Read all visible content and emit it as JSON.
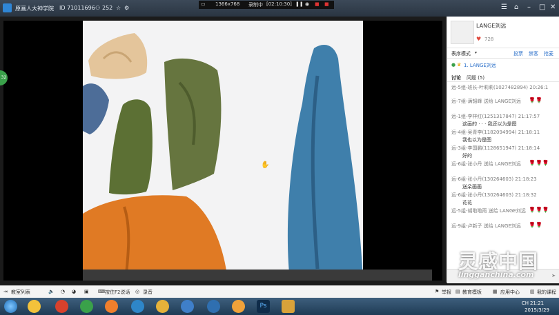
{
  "window": {
    "room_name": "原画人大神学院",
    "room_id": "ID 71011696",
    "online_count": "252"
  },
  "recorder": {
    "resolution": "1366x768",
    "status": "录制中",
    "time": "[02:10:30]"
  },
  "streamer": {
    "name": "LANGE刘远",
    "likes": "728"
  },
  "panel": {
    "mode_label": "表序模式",
    "links": [
      "投票",
      "禁客",
      "抢麦"
    ],
    "mic_queue_item": "1. LANGE刘远",
    "tabs": [
      "讨论",
      "问题 (5)"
    ],
    "comments": [
      {
        "type": "msg",
        "name": "远-5组-班长-叶莉莉(1027482894) 20:26:1",
        "text": ""
      },
      {
        "type": "gift",
        "name": "远-7组-满韶峰 送给 LANGE刘远",
        "count": 2
      },
      {
        "type": "msg",
        "name": "远-1组-李梓红(1251317847) 21:17:57",
        "text": "这画的 · · · 我还以为是图"
      },
      {
        "type": "msg",
        "name": "远-4组-吴青李(1182094994) 21:18:11",
        "text": "我也以为是图"
      },
      {
        "type": "msg",
        "name": "远-3组-李国鹏(1128651947) 21:18:14",
        "text": "好的"
      },
      {
        "type": "gift",
        "name": "远-6组-张小丹 送给 LANGE刘远",
        "count": 3
      },
      {
        "type": "msg",
        "name": "远-6组-张小丹(130264603) 21:18:23",
        "text": "送朵画画"
      },
      {
        "type": "msg",
        "name": "远-6组-张小丹(130264603) 21:18:32",
        "text": "花花"
      },
      {
        "type": "gift",
        "name": "远-5组-胡啦啦雨 送给 LANGE刘远",
        "count": 3
      },
      {
        "type": "gift",
        "name": "远-9组-卢新子 送给 LANGE刘远",
        "count": 2
      }
    ]
  },
  "controls": {
    "classroom_list": "教室列表",
    "push_to_talk": "按住F2说话",
    "record": "录音",
    "report": "举报",
    "room_template": "教育模板",
    "app_center": "应用中心",
    "my_courses": "我的课程"
  },
  "taskbar": {
    "ime": "CH",
    "time": "21:21",
    "date": "2015/3/29"
  },
  "watermark": {
    "name": "灵感中国",
    "url": "lingganchina.com"
  },
  "colors": {
    "accent": "#2a6fc9",
    "flower": "#d0262b"
  }
}
